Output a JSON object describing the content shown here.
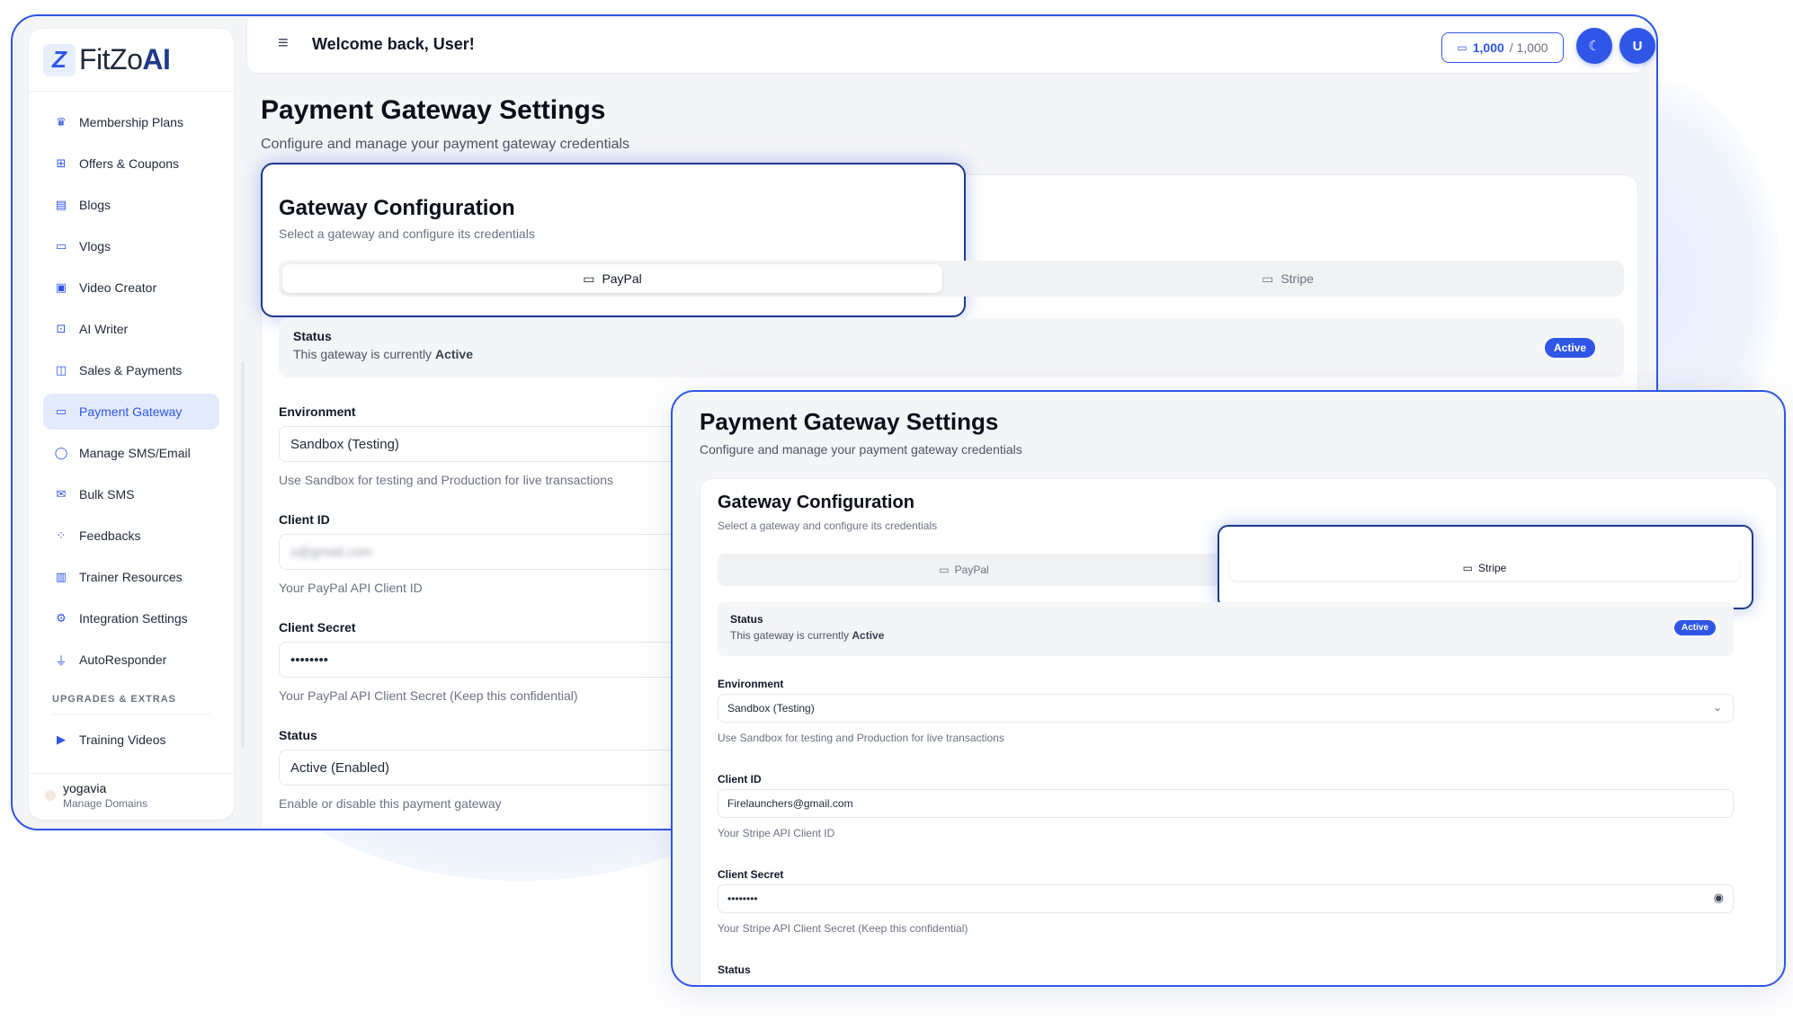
{
  "header": {
    "welcome": "Welcome back, User!",
    "credits_used": "1,000",
    "credits_total": "/ 1,000",
    "avatar_initial": "U",
    "theme_icon": "moon-icon"
  },
  "brand": {
    "logo_prefix": "FitZo",
    "logo_suffix": "AI",
    "accent": "#2f56e6"
  },
  "sidebar": {
    "items": [
      {
        "label": "Membership Plans",
        "icon": "crown-icon"
      },
      {
        "label": "Offers & Coupons",
        "icon": "gift-icon"
      },
      {
        "label": "Blogs",
        "icon": "document-icon"
      },
      {
        "label": "Vlogs",
        "icon": "video-icon"
      },
      {
        "label": "Video Creator",
        "icon": "clapper-icon"
      },
      {
        "label": "AI Writer",
        "icon": "bot-icon"
      },
      {
        "label": "Sales & Payments",
        "icon": "wallet-icon"
      },
      {
        "label": "Payment Gateway",
        "icon": "credit-card-icon",
        "active": true
      },
      {
        "label": "Manage SMS/Email",
        "icon": "chat-icon"
      },
      {
        "label": "Bulk SMS",
        "icon": "mail-icon"
      },
      {
        "label": "Feedbacks",
        "icon": "loader-icon"
      },
      {
        "label": "Trainer Resources",
        "icon": "library-icon"
      },
      {
        "label": "Integration Settings",
        "icon": "gear-icon"
      },
      {
        "label": "AutoResponder",
        "icon": "plug-icon"
      }
    ],
    "section_label": "UPGRADES & EXTRAS",
    "extras": [
      {
        "label": "Training Videos",
        "icon": "monitor-play-icon"
      }
    ],
    "footer": {
      "name": "yogavia",
      "sub": "Manage Domains"
    }
  },
  "page": {
    "title": "Payment Gateway Settings",
    "subtitle": "Configure and manage your payment gateway credentials"
  },
  "config": {
    "title": "Gateway Configuration",
    "subtitle": "Select a gateway and configure its credentials",
    "tabs": [
      {
        "label": "PayPal"
      },
      {
        "label": "Stripe"
      }
    ]
  },
  "paypal": {
    "status_label": "Status",
    "status_text": "This gateway is currently",
    "status_value": "Active",
    "badge": "Active",
    "environment_label": "Environment",
    "environment_value": "Sandbox (Testing)",
    "environment_help": "Use Sandbox for testing and Production for live transactions",
    "client_id_label": "Client ID",
    "client_id_value": "s@gmail.com",
    "client_id_help": "Your PayPal API Client ID",
    "client_secret_label": "Client Secret",
    "client_secret_value": "••••••••",
    "client_secret_help": "Your PayPal API Client Secret (Keep this confidential)",
    "gateway_status_label": "Status",
    "gateway_status_value": "Active (Enabled)",
    "gateway_status_help": "Enable or disable this payment gateway"
  },
  "stripe": {
    "title": "Payment Gateway Settings",
    "subtitle": "Configure and manage your payment gateway credentials",
    "config_title": "Gateway Configuration",
    "config_subtitle": "Select a gateway and configure its credentials",
    "tabs": [
      {
        "label": "PayPal"
      },
      {
        "label": "Stripe"
      }
    ],
    "status_label": "Status",
    "status_text": "This gateway is currently",
    "status_value": "Active",
    "badge": "Active",
    "environment_label": "Environment",
    "environment_value": "Sandbox (Testing)",
    "environment_help": "Use Sandbox for testing and Production for live transactions",
    "client_id_label": "Client ID",
    "client_id_value": "Firelaunchers@gmail.com",
    "client_id_help": "Your Stripe API Client ID",
    "client_secret_label": "Client Secret",
    "client_secret_value": "••••••••",
    "client_secret_help": "Your Stripe API Client Secret (Keep this confidential)",
    "gateway_status_label": "Status"
  }
}
